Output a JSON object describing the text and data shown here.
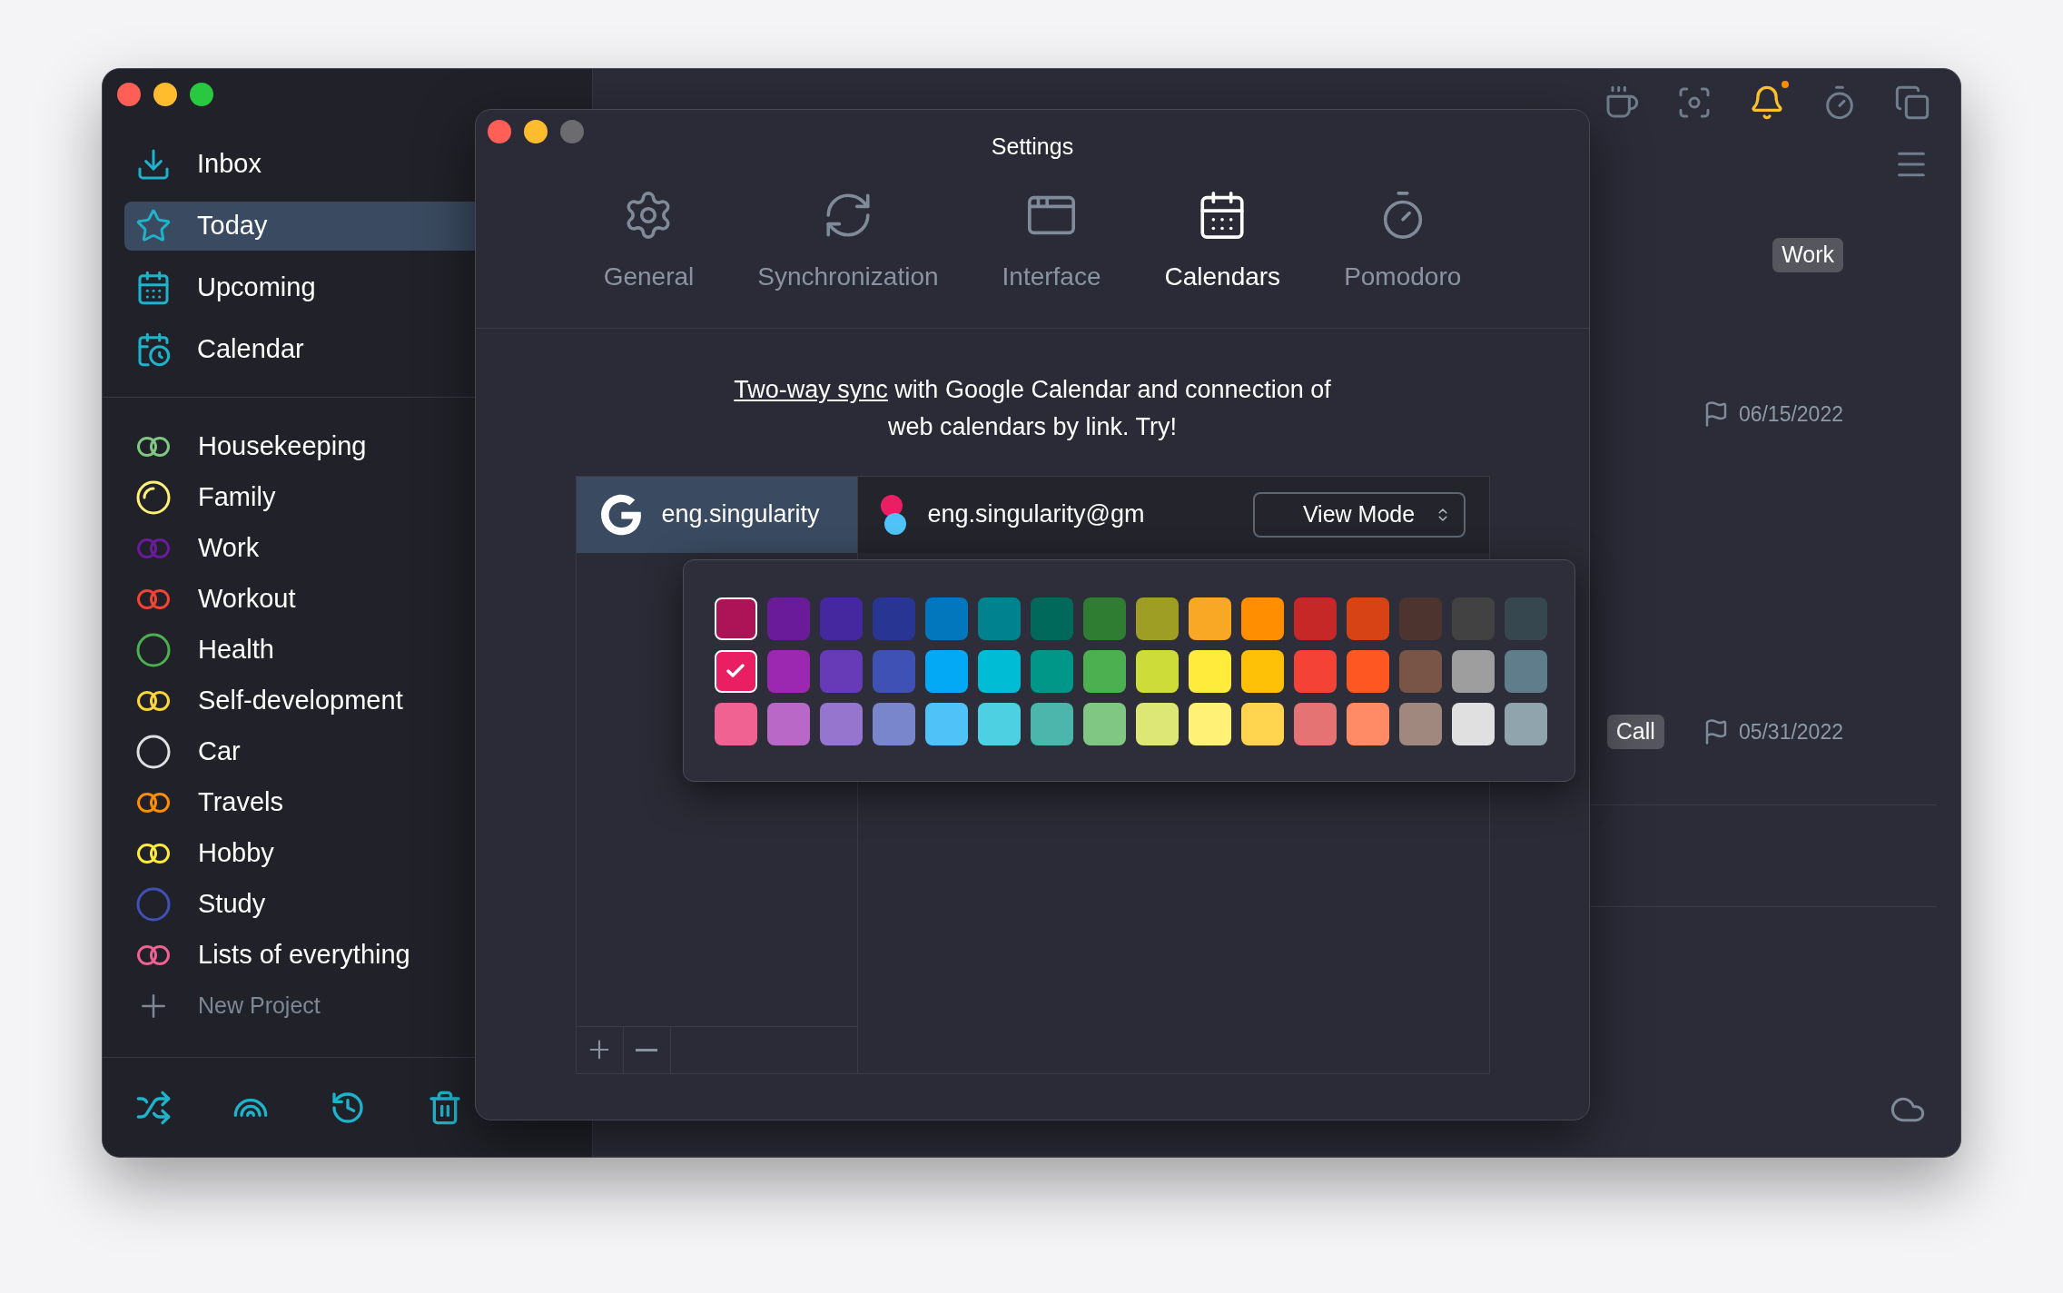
{
  "app": {
    "window": {
      "zoom_enabled": true
    },
    "sidebar": {
      "nav": [
        {
          "label": "Inbox",
          "kind": "inbox",
          "selected": false
        },
        {
          "label": "Today",
          "kind": "today",
          "selected": true
        },
        {
          "label": "Upcoming",
          "kind": "upcoming",
          "selected": false
        },
        {
          "label": "Calendar",
          "kind": "calendar",
          "selected": false
        }
      ],
      "projects": [
        {
          "label": "Housekeeping",
          "kind": "double",
          "color": "#81c784"
        },
        {
          "label": "Family",
          "kind": "partial",
          "color": "#fff176"
        },
        {
          "label": "Work",
          "kind": "double",
          "color": "#6a1b9a"
        },
        {
          "label": "Workout",
          "kind": "double",
          "color": "#f44336"
        },
        {
          "label": "Health",
          "kind": "single",
          "color": "#4caf50"
        },
        {
          "label": "Self-development",
          "kind": "double",
          "color": "#fdd835"
        },
        {
          "label": "Car",
          "kind": "single",
          "color": "#e0e0e0"
        },
        {
          "label": "Travels",
          "kind": "double",
          "color": "#ff8f00"
        },
        {
          "label": "Hobby",
          "kind": "double",
          "color": "#ffeb3b"
        },
        {
          "label": "Study",
          "kind": "single",
          "color": "#3f51b5"
        },
        {
          "label": "Lists of everything",
          "kind": "double",
          "color": "#f06292"
        }
      ],
      "new_project": "New Project"
    },
    "main": {
      "rows": [
        {
          "tag": "Work"
        },
        {
          "date": "06/15/2022"
        },
        {
          "tag": "Call",
          "date": "05/31/2022"
        }
      ]
    }
  },
  "settings": {
    "window": {
      "title": "Settings",
      "zoom_enabled": false
    },
    "tabs": [
      {
        "label": "General",
        "kind": "general",
        "selected": false
      },
      {
        "label": "Synchronization",
        "kind": "sync",
        "selected": false
      },
      {
        "label": "Interface",
        "kind": "interface",
        "selected": false
      },
      {
        "label": "Calendars",
        "kind": "calendars",
        "selected": true
      },
      {
        "label": "Pomodoro",
        "kind": "pomodoro",
        "selected": false
      }
    ],
    "intro": {
      "link": "Two-way sync",
      "text": " with Google Calendar and connection of web calendars by link. Try!"
    },
    "accounts": [
      {
        "label": "eng.singularity",
        "selected": true
      }
    ],
    "calendar": {
      "name": "eng.singularity@gm",
      "mode": "View Mode"
    },
    "palette": [
      [
        {
          "color": "#ad1457",
          "selected": false,
          "outlined": true
        },
        {
          "color": "#6a1b9a",
          "selected": false,
          "outlined": false
        },
        {
          "color": "#4527a0",
          "selected": false,
          "outlined": false
        },
        {
          "color": "#283593",
          "selected": false,
          "outlined": false
        },
        {
          "color": "#0277bd",
          "selected": false,
          "outlined": false
        },
        {
          "color": "#00838f",
          "selected": false,
          "outlined": false
        },
        {
          "color": "#00695c",
          "selected": false,
          "outlined": false
        },
        {
          "color": "#2e7d32",
          "selected": false,
          "outlined": false
        },
        {
          "color": "#9e9d24",
          "selected": false,
          "outlined": false
        },
        {
          "color": "#f9a825",
          "selected": false,
          "outlined": false
        },
        {
          "color": "#ff8f00",
          "selected": false,
          "outlined": false
        },
        {
          "color": "#c62828",
          "selected": false,
          "outlined": false
        },
        {
          "color": "#d84315",
          "selected": false,
          "outlined": false
        },
        {
          "color": "#4e342e",
          "selected": false,
          "outlined": false
        },
        {
          "color": "#424242",
          "selected": false,
          "outlined": false
        },
        {
          "color": "#37474f",
          "selected": false,
          "outlined": false
        }
      ],
      [
        {
          "color": "#e91e63",
          "selected": true,
          "outlined": true
        },
        {
          "color": "#9c27b0",
          "selected": false,
          "outlined": false
        },
        {
          "color": "#673ab7",
          "selected": false,
          "outlined": false
        },
        {
          "color": "#3f51b5",
          "selected": false,
          "outlined": false
        },
        {
          "color": "#03a9f4",
          "selected": false,
          "outlined": false
        },
        {
          "color": "#00bcd4",
          "selected": false,
          "outlined": false
        },
        {
          "color": "#009688",
          "selected": false,
          "outlined": false
        },
        {
          "color": "#4caf50",
          "selected": false,
          "outlined": false
        },
        {
          "color": "#cddc39",
          "selected": false,
          "outlined": false
        },
        {
          "color": "#ffeb3b",
          "selected": false,
          "outlined": false
        },
        {
          "color": "#ffc107",
          "selected": false,
          "outlined": false
        },
        {
          "color": "#f44336",
          "selected": false,
          "outlined": false
        },
        {
          "color": "#ff5722",
          "selected": false,
          "outlined": false
        },
        {
          "color": "#795548",
          "selected": false,
          "outlined": false
        },
        {
          "color": "#9e9e9e",
          "selected": false,
          "outlined": false
        },
        {
          "color": "#607d8b",
          "selected": false,
          "outlined": false
        }
      ],
      [
        {
          "color": "#f06292",
          "selected": false,
          "outlined": false
        },
        {
          "color": "#ba68c8",
          "selected": false,
          "outlined": false
        },
        {
          "color": "#9575cd",
          "selected": false,
          "outlined": false
        },
        {
          "color": "#7986cb",
          "selected": false,
          "outlined": false
        },
        {
          "color": "#4fc3f7",
          "selected": false,
          "outlined": false
        },
        {
          "color": "#4dd0e1",
          "selected": false,
          "outlined": false
        },
        {
          "color": "#4db6ac",
          "selected": false,
          "outlined": false
        },
        {
          "color": "#81c784",
          "selected": false,
          "outlined": false
        },
        {
          "color": "#dce775",
          "selected": false,
          "outlined": false
        },
        {
          "color": "#fff176",
          "selected": false,
          "outlined": false
        },
        {
          "color": "#ffd54f",
          "selected": false,
          "outlined": false
        },
        {
          "color": "#e57373",
          "selected": false,
          "outlined": false
        },
        {
          "color": "#ff8a65",
          "selected": false,
          "outlined": false
        },
        {
          "color": "#a1887f",
          "selected": false,
          "outlined": false
        },
        {
          "color": "#e0e0e0",
          "selected": false,
          "outlined": false
        },
        {
          "color": "#90a4ae",
          "selected": false,
          "outlined": false
        }
      ]
    ]
  }
}
